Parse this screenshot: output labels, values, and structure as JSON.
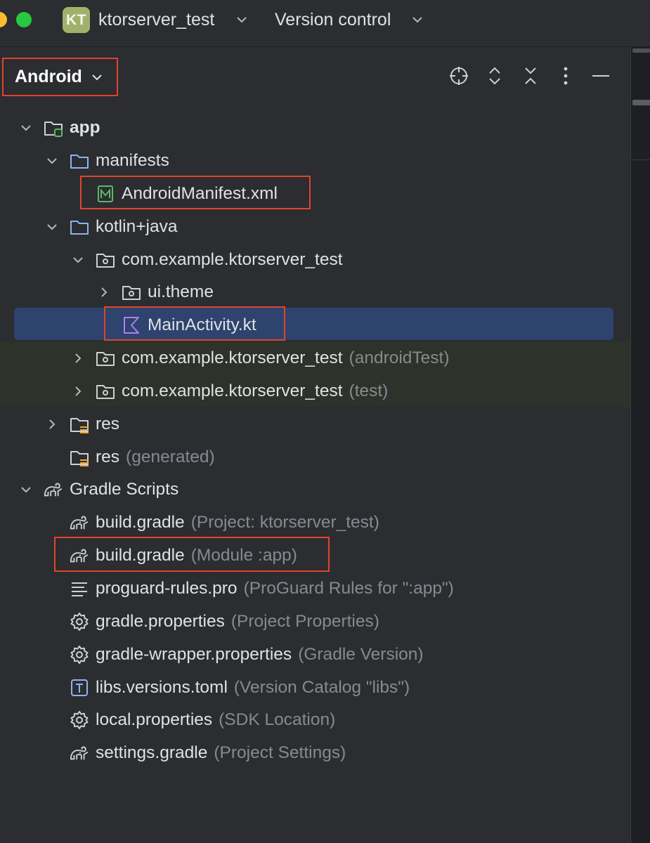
{
  "titlebar": {
    "project_badge": "KT",
    "project_name": "ktorserver_test",
    "vcs_label": "Version control"
  },
  "panel": {
    "view_label": "Android",
    "header_icons": [
      "locate-icon",
      "expand-all-icon",
      "collapse-all-icon",
      "more-options-icon",
      "hide-panel-icon"
    ]
  },
  "tree": [
    {
      "name": "app",
      "hint": "",
      "icon": "module-folder-icon",
      "state": "expanded"
    },
    {
      "name": "manifests",
      "hint": "",
      "icon": "folder-icon",
      "state": "expanded"
    },
    {
      "name": "AndroidManifest.xml",
      "hint": "",
      "icon": "manifest-file-icon",
      "state": "leaf"
    },
    {
      "name": "kotlin+java",
      "hint": "",
      "icon": "folder-icon",
      "state": "expanded"
    },
    {
      "name": "com.example.ktorserver_test",
      "hint": "",
      "icon": "package-icon",
      "state": "expanded"
    },
    {
      "name": "ui.theme",
      "hint": "",
      "icon": "package-icon",
      "state": "collapsed"
    },
    {
      "name": "MainActivity.kt",
      "hint": "",
      "icon": "kotlin-file-icon",
      "state": "leaf",
      "selected": true
    },
    {
      "name": "com.example.ktorserver_test",
      "hint": "(androidTest)",
      "icon": "package-icon",
      "state": "collapsed"
    },
    {
      "name": "com.example.ktorserver_test",
      "hint": "(test)",
      "icon": "package-icon",
      "state": "collapsed"
    },
    {
      "name": "res",
      "hint": "",
      "icon": "resource-folder-icon",
      "state": "collapsed"
    },
    {
      "name": "res",
      "hint": "(generated)",
      "icon": "resource-folder-icon",
      "state": "leaf"
    },
    {
      "name": "Gradle Scripts",
      "hint": "",
      "icon": "gradle-icon",
      "state": "expanded"
    },
    {
      "name": "build.gradle",
      "hint": "(Project: ktorserver_test)",
      "icon": "gradle-icon",
      "state": "leaf"
    },
    {
      "name": "build.gradle",
      "hint": "(Module :app)",
      "icon": "gradle-icon",
      "state": "leaf"
    },
    {
      "name": "proguard-rules.pro",
      "hint": "(ProGuard Rules for \":app\")",
      "icon": "text-file-icon",
      "state": "leaf"
    },
    {
      "name": "gradle.properties",
      "hint": "(Project Properties)",
      "icon": "settings-gear-icon",
      "state": "leaf"
    },
    {
      "name": "gradle-wrapper.properties",
      "hint": "(Gradle Version)",
      "icon": "settings-gear-icon",
      "state": "leaf"
    },
    {
      "name": "libs.versions.toml",
      "hint": "(Version Catalog \"libs\")",
      "icon": "toml-file-icon",
      "state": "leaf"
    },
    {
      "name": "local.properties",
      "hint": "(SDK Location)",
      "icon": "settings-gear-icon",
      "state": "leaf"
    },
    {
      "name": "settings.gradle",
      "hint": "(Project Settings)",
      "icon": "gradle-icon",
      "state": "leaf"
    }
  ],
  "colors": {
    "background": "#2b2d30",
    "selection": "#2e436e",
    "test_source_band": "#2d322b",
    "annotation_box": "#e0442c",
    "hint_text": "#868a91"
  }
}
